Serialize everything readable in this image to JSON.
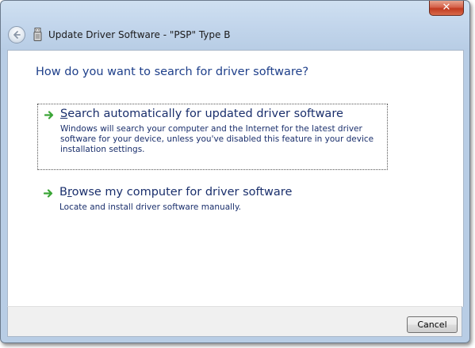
{
  "window": {
    "title": "Update Driver Software - \"PSP\" Type B",
    "close_label": "✕"
  },
  "content": {
    "heading": "How do you want to search for driver software?",
    "options": [
      {
        "title_hotkey": "S",
        "title_rest": "earch automatically for updated driver software",
        "description": "Windows will search your computer and the Internet for the latest driver software for your device, unless you've disabled this feature in your device installation settings."
      },
      {
        "title_first": "B",
        "title_hotkey": "r",
        "title_rest": "owse my computer for driver software",
        "description": "Locate and install driver software manually."
      }
    ]
  },
  "footer": {
    "cancel_label": "Cancel"
  },
  "icons": {
    "back": "back-arrow-icon",
    "device": "usb-device-icon",
    "option_arrow": "green-arrow-icon"
  },
  "colors": {
    "heading": "#1e3f8a",
    "option_text": "#1a2f6c",
    "arrow_green": "#3aa536"
  }
}
